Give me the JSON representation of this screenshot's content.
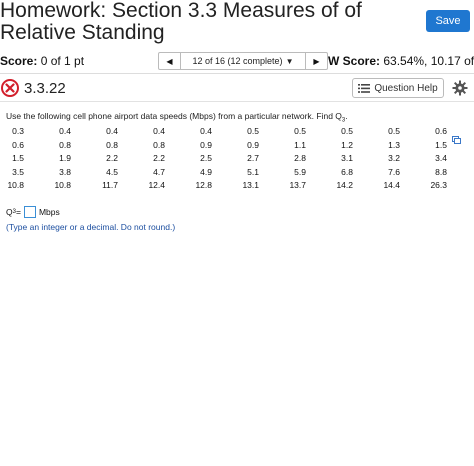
{
  "header": {
    "title_line1": "Homework: Section 3.3 Measures of of",
    "title_line2": "Relative Standing",
    "save_label": "Save"
  },
  "score_bar": {
    "score_label": "Score:",
    "score_value": "0 of 1 pt",
    "pager_text": "12 of 16 (12 complete)",
    "hw_label": "W Score:",
    "hw_value": "63.54%, 10.17 of..."
  },
  "question": {
    "number": "3.3.22",
    "help_label": "Question Help",
    "prompt": "Use the following cell phone airport data speeds (Mbps) from a particular network. Find Q",
    "prompt_sub": "3",
    "prompt_end": ".",
    "answer_label": "Q",
    "answer_sub": "3",
    "answer_eq": " = ",
    "answer_value": "",
    "answer_unit": "Mbps",
    "hint": "(Type an integer or a decimal. Do not round.)"
  },
  "data_rows": [
    [
      "0.3",
      "0.4",
      "0.4",
      "0.4",
      "0.4",
      "0.5",
      "0.5",
      "0.5",
      "0.5",
      "0.6"
    ],
    [
      "0.6",
      "0.8",
      "0.8",
      "0.8",
      "0.9",
      "0.9",
      "1.1",
      "1.2",
      "1.3",
      "1.5"
    ],
    [
      "1.5",
      "1.9",
      "2.2",
      "2.2",
      "2.5",
      "2.7",
      "2.8",
      "3.1",
      "3.2",
      "3.4"
    ],
    [
      "3.5",
      "3.8",
      "4.5",
      "4.7",
      "4.9",
      "5.1",
      "5.9",
      "6.8",
      "7.6",
      "8.8"
    ],
    [
      "10.8",
      "10.8",
      "11.7",
      "12.4",
      "12.8",
      "13.1",
      "13.7",
      "14.2",
      "14.4",
      "26.3"
    ]
  ],
  "icons": {
    "incorrect": "x-circle-icon",
    "help": "list-icon",
    "settings": "gear-icon",
    "copy": "copy-icon"
  },
  "colors": {
    "save_button": "#1f77d0",
    "incorrect_red": "#d21f2b",
    "hint_blue": "#1d4fa0"
  }
}
